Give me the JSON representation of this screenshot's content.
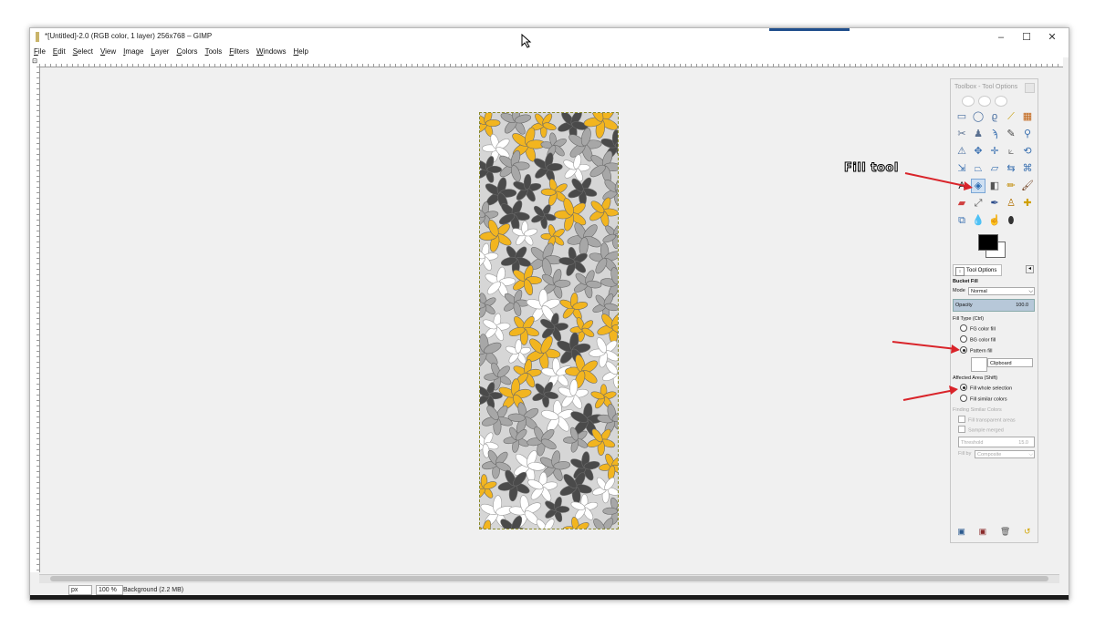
{
  "window": {
    "title": "*[Untitled]-2.0 (RGB color, 1 layer) 256x768 – GIMP",
    "minimize": "–",
    "maximize": "☐",
    "close": "✕"
  },
  "menu": [
    "File",
    "Edit",
    "Select",
    "View",
    "Image",
    "Layer",
    "Colors",
    "Tools",
    "Filters",
    "Windows",
    "Help"
  ],
  "status": {
    "unit": "px",
    "zoom": "100 %",
    "layer_info": "Background (2.2 MB)"
  },
  "toolbox": {
    "title": "Toolbox - Tool Options",
    "tools": [
      {
        "icon": "rect-select-icon",
        "glyph": "▭"
      },
      {
        "icon": "ellipse-select-icon",
        "glyph": "◯"
      },
      {
        "icon": "free-select-icon",
        "glyph": "ϱ"
      },
      {
        "icon": "fuzzy-select-icon",
        "glyph": "⟋"
      },
      {
        "icon": "color-select-icon",
        "glyph": "▦"
      },
      {
        "icon": "scissors-icon",
        "glyph": "✂"
      },
      {
        "icon": "foreground-select-icon",
        "glyph": "♟"
      },
      {
        "icon": "paths-icon",
        "glyph": "ϡ"
      },
      {
        "icon": "color-picker-icon",
        "glyph": "✎"
      },
      {
        "icon": "zoom-icon",
        "glyph": "⚲"
      },
      {
        "icon": "measure-icon",
        "glyph": "⚠"
      },
      {
        "icon": "move-icon",
        "glyph": "✥"
      },
      {
        "icon": "align-icon",
        "glyph": "✛"
      },
      {
        "icon": "crop-icon",
        "glyph": "⟀"
      },
      {
        "icon": "rotate-icon",
        "glyph": "⟲"
      },
      {
        "icon": "scale-icon",
        "glyph": "⇲"
      },
      {
        "icon": "shear-icon",
        "glyph": "⏢"
      },
      {
        "icon": "perspective-icon",
        "glyph": "⏥"
      },
      {
        "icon": "flip-icon",
        "glyph": "⇆"
      },
      {
        "icon": "cage-icon",
        "glyph": "⌘"
      },
      {
        "icon": "text-icon",
        "glyph": "A"
      },
      {
        "icon": "bucket-fill-icon",
        "glyph": "◈"
      },
      {
        "icon": "blend-icon",
        "glyph": "◧"
      },
      {
        "icon": "pencil-icon",
        "glyph": "✏"
      },
      {
        "icon": "paintbrush-icon",
        "glyph": "🖌"
      },
      {
        "icon": "eraser-icon",
        "glyph": "▰"
      },
      {
        "icon": "airbrush-icon",
        "glyph": "⤢"
      },
      {
        "icon": "ink-icon",
        "glyph": "✒"
      },
      {
        "icon": "clone-icon",
        "glyph": "♙"
      },
      {
        "icon": "heal-icon",
        "glyph": "✚"
      },
      {
        "icon": "perspective-clone-icon",
        "glyph": "⧉"
      },
      {
        "icon": "blur-icon",
        "glyph": "💧"
      },
      {
        "icon": "smudge-icon",
        "glyph": "☝"
      },
      {
        "icon": "dodge-burn-icon",
        "glyph": "⬮"
      }
    ]
  },
  "tool_options": {
    "tab_label": "Tool Options",
    "tool_name": "Bucket Fill",
    "mode_label": "Mode",
    "mode_value": "Normal",
    "opacity_label": "Opacity",
    "opacity_value": "100.0",
    "fill_type_label": "Fill Type  (Ctrl)",
    "fill_fg": "FG color fill",
    "fill_bg": "BG color fill",
    "fill_pattern": "Pattern fill",
    "pattern_name": "Clipboard",
    "affected_area_label": "Affected Area  (Shift)",
    "area_whole": "Fill whole selection",
    "area_similar": "Fill similar colors",
    "finding_similar_label": "Finding Similar Colors",
    "fill_transparent": "Fill transparent areas",
    "sample_merged": "Sample merged",
    "threshold_label": "Threshold",
    "threshold_value": "15.0",
    "fill_by_label": "Fill by",
    "fill_by_value": "Composite"
  },
  "annotation": {
    "fill_tool_label": "Fill tool"
  },
  "colors": {
    "leaf_yellow": "#f2b51f",
    "leaf_dark": "#4a4a4a",
    "leaf_grey": "#a7a7a7",
    "leaf_white": "#ffffff",
    "canvas_bg": "#d6d6d6",
    "annotation_arrow": "#d9242a"
  }
}
